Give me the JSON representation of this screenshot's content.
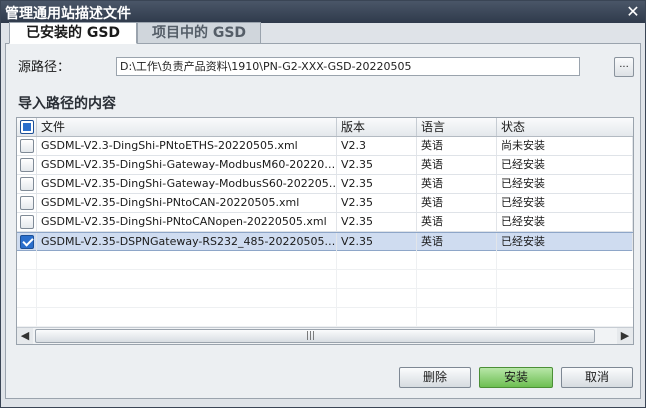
{
  "window": {
    "title": "管理通用站描述文件",
    "close_symbol": "✕"
  },
  "tabs": [
    {
      "label": "已安装的 GSD",
      "active": true
    },
    {
      "label": "项目中的 GSD",
      "active": false
    }
  ],
  "source": {
    "label": "源路径：",
    "path": "D:\\工作\\负责产品资料\\1910\\PN-G2-XXX-GSD-20220505",
    "browse_label": "..."
  },
  "section_title": "导入路径的内容",
  "table": {
    "headers": {
      "file": "文件",
      "version": "版本",
      "language": "语言",
      "status": "状态"
    },
    "rows": [
      {
        "checked": false,
        "file": "GSDML-V2.3-DingShi-PNtoETHS-20220505.xml",
        "version": "V2.3",
        "language": "英语",
        "status": "尚未安装"
      },
      {
        "checked": false,
        "file": "GSDML-V2.35-DingShi-Gateway-ModbusM60-20220…",
        "version": "V2.35",
        "language": "英语",
        "status": "已经安装"
      },
      {
        "checked": false,
        "file": "GSDML-V2.35-DingShi-Gateway-ModbusS60-202205…",
        "version": "V2.35",
        "language": "英语",
        "status": "已经安装"
      },
      {
        "checked": false,
        "file": "GSDML-V2.35-DingShi-PNtoCAN-20220505.xml",
        "version": "V2.35",
        "language": "英语",
        "status": "已经安装"
      },
      {
        "checked": false,
        "file": "GSDML-V2.35-DingShi-PNtoCANopen-20220505.xml",
        "version": "V2.35",
        "language": "英语",
        "status": "已经安装"
      },
      {
        "checked": true,
        "file": "GSDML-V2.35-DSPNGateway-RS232_485-20220505.…",
        "version": "V2.35",
        "language": "英语",
        "status": "已经安装"
      }
    ],
    "scroll_grip": "|||"
  },
  "buttons": {
    "delete": "删除",
    "install": "安装",
    "cancel": "取消"
  },
  "colors": {
    "install_button": "#6dbf52",
    "selected_row": "#cfdcf0",
    "checkbox_checked": "#2b6fcc"
  }
}
